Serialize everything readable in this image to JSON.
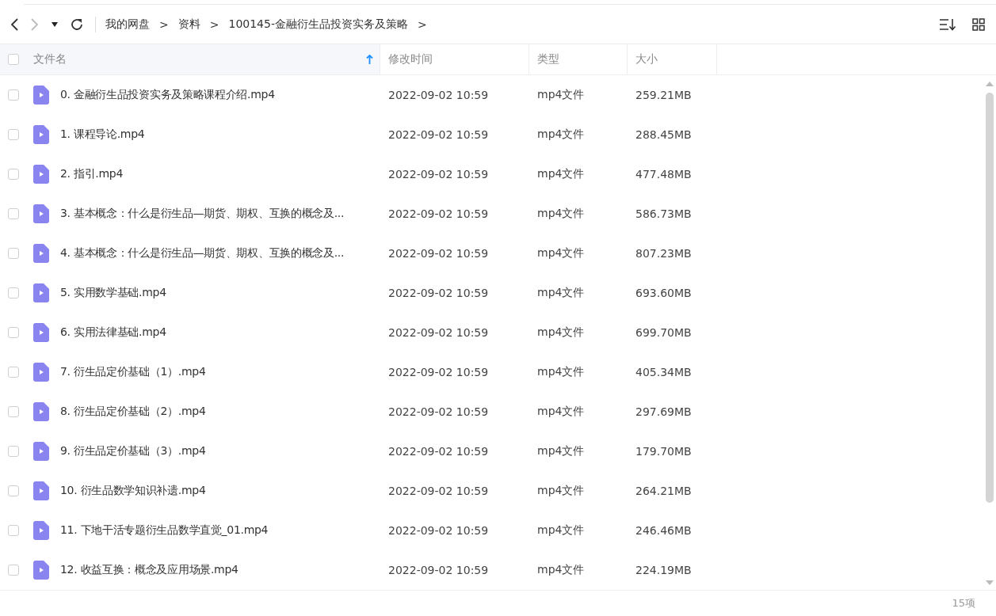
{
  "toolbar": {
    "back_disabled": false,
    "forward_disabled": true,
    "breadcrumb": [
      {
        "label": "我的网盘"
      },
      {
        "label": "资料"
      },
      {
        "label": "100145-金融衍生品投资实务及策略"
      }
    ],
    "separator": ">"
  },
  "table": {
    "all_checked": false,
    "columns": [
      {
        "label": "文件名",
        "sorted": true
      },
      {
        "label": "修改时间",
        "sorted": false
      },
      {
        "label": "类型",
        "sorted": false
      },
      {
        "label": "大小",
        "sorted": false
      }
    ],
    "rows": [
      {
        "name": "0. 金融衍生品投资实务及策略课程介绍.mp4",
        "modified": "2022-09-02 10:59",
        "type": "mp4文件",
        "size": "259.21MB",
        "checked": false
      },
      {
        "name": "1. 课程导论.mp4",
        "modified": "2022-09-02 10:59",
        "type": "mp4文件",
        "size": "288.45MB",
        "checked": false
      },
      {
        "name": "2. 指引.mp4",
        "modified": "2022-09-02 10:59",
        "type": "mp4文件",
        "size": "477.48MB",
        "checked": false
      },
      {
        "name": "3. 基本概念：什么是衍生品—期货、期权、互换的概念及...",
        "modified": "2022-09-02 10:59",
        "type": "mp4文件",
        "size": "586.73MB",
        "checked": false
      },
      {
        "name": "4. 基本概念：什么是衍生品—期货、期权、互换的概念及...",
        "modified": "2022-09-02 10:59",
        "type": "mp4文件",
        "size": "807.23MB",
        "checked": false
      },
      {
        "name": "5. 实用数学基础.mp4",
        "modified": "2022-09-02 10:59",
        "type": "mp4文件",
        "size": "693.60MB",
        "checked": false
      },
      {
        "name": "6. 实用法律基础.mp4",
        "modified": "2022-09-02 10:59",
        "type": "mp4文件",
        "size": "699.70MB",
        "checked": false
      },
      {
        "name": "7. 衍生品定价基础（1）.mp4",
        "modified": "2022-09-02 10:59",
        "type": "mp4文件",
        "size": "405.34MB",
        "checked": false
      },
      {
        "name": "8. 衍生品定价基础（2）.mp4",
        "modified": "2022-09-02 10:59",
        "type": "mp4文件",
        "size": "297.69MB",
        "checked": false
      },
      {
        "name": "9. 衍生品定价基础（3）.mp4",
        "modified": "2022-09-02 10:59",
        "type": "mp4文件",
        "size": "179.70MB",
        "checked": false
      },
      {
        "name": "10. 衍生品数学知识补遗.mp4",
        "modified": "2022-09-02 10:59",
        "type": "mp4文件",
        "size": "264.21MB",
        "checked": false
      },
      {
        "name": "11. 下地干活专题衍生品数学直觉_01.mp4",
        "modified": "2022-09-02 10:59",
        "type": "mp4文件",
        "size": "246.46MB",
        "checked": false
      },
      {
        "name": "12. 收益互换：概念及应用场景.mp4",
        "modified": "2022-09-02 10:59",
        "type": "mp4文件",
        "size": "224.19MB",
        "checked": false
      }
    ]
  },
  "status_bar": {
    "count": "15项"
  }
}
